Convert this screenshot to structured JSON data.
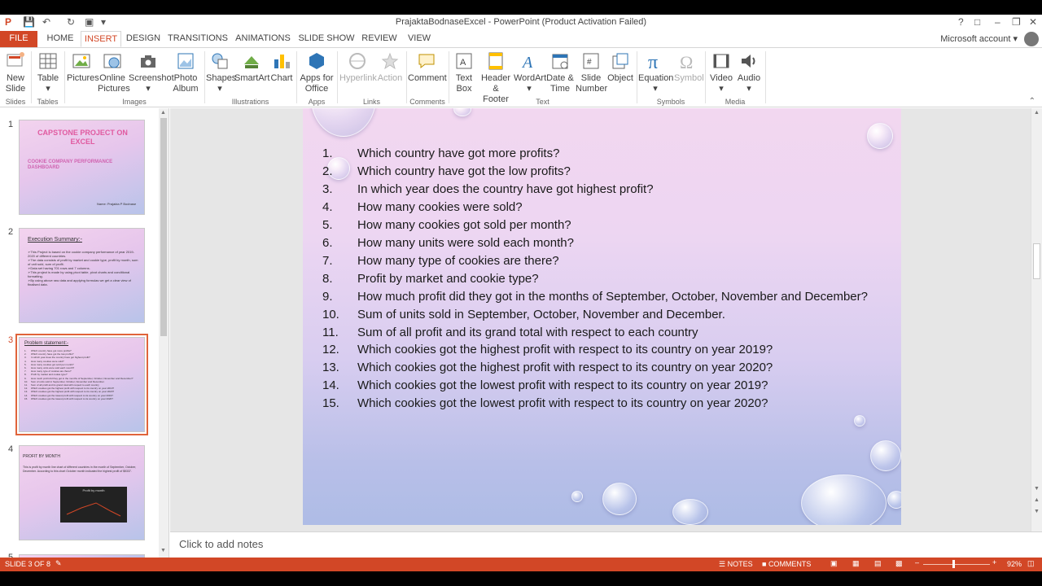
{
  "window": {
    "title": "PrajaktaBodnaseExcel - PowerPoint (Product Activation Failed)",
    "account": "Microsoft account",
    "help": "?"
  },
  "tabs": [
    "FILE",
    "HOME",
    "INSERT",
    "DESIGN",
    "TRANSITIONS",
    "ANIMATIONS",
    "SLIDE SHOW",
    "REVIEW",
    "VIEW"
  ],
  "active_tab": "INSERT",
  "ribbon": {
    "buttons": {
      "new_slide": "New Slide",
      "table": "Table",
      "pictures": "Pictures",
      "online_pictures": "Online Pictures",
      "screenshot": "Screenshot",
      "photo_album": "Photo Album",
      "shapes": "Shapes",
      "smartart": "SmartArt",
      "chart": "Chart",
      "apps_for_office": "Apps for Office",
      "hyperlink": "Hyperlink",
      "action": "Action",
      "comment": "Comment",
      "text_box": "Text Box",
      "header_footer": "Header & Footer",
      "wordart": "WordArt",
      "date_time": "Date & Time",
      "slide_number": "Slide Number",
      "object": "Object",
      "equation": "Equation",
      "symbol": "Symbol",
      "video": "Video",
      "audio": "Audio"
    },
    "groups": {
      "slides": "Slides",
      "tables": "Tables",
      "images": "Images",
      "illustrations": "Illustrations",
      "apps": "Apps",
      "links": "Links",
      "comments": "Comments",
      "text": "Text",
      "symbols": "Symbols",
      "media": "Media"
    }
  },
  "thumbnails": {
    "numbers": [
      "1",
      "2",
      "3",
      "4",
      "5"
    ],
    "slide1": {
      "title": "CAPSTONE PROJECT ON EXCEL",
      "subtitle": "COOKIE COMPANY PERFORMANCE DASHBOARD",
      "name": "Name: Prajakta P Bodnase"
    },
    "slide2": {
      "title": "Execution Summary:-",
      "lines": [
        "➢This Project is based on the cookie company performance of year 2019-2020 of different countries.",
        "➢The data consists of profit by market and cookie type, profit by month, sum of unit sold, sum of profit.",
        "➢Data set having 701 rows and 7 columns.",
        "➢This project is made by using pivot table, pivot charts and conditional formatting.",
        "➢By using above raw data and applying formulas we get a clear view of finalised data."
      ]
    },
    "slide3": {
      "title": "Problem statement:-"
    },
    "slide4": {
      "title": "PROFIT BY MONTH",
      "text": "This is profit by month line chart of different countries in the month of September, October, December. According to this chart October month indicated the highest profit of $5337.",
      "chart_title": "Profit by month"
    }
  },
  "slide": {
    "questions": [
      {
        "num": "1.",
        "text": "Which country have got more profits?"
      },
      {
        "num": "2.",
        "text": "Which country have got the low profits?"
      },
      {
        "num": "3.",
        "text": "In which year does the country have got highest profit?"
      },
      {
        "num": "4.",
        "text": "How many cookies were sold?"
      },
      {
        "num": "5.",
        "text": "How many cookies got sold per month?"
      },
      {
        "num": "6.",
        "text": "How many units were sold each month?"
      },
      {
        "num": "7.",
        "text": "How many type of cookies are there?"
      },
      {
        "num": "8.",
        "text": "Profit by market and cookie type?"
      },
      {
        "num": "9.",
        "text": "How much profit did they got in the months of September, October, November and December?"
      },
      {
        "num": "10.",
        "text": "Sum of units sold in September, October, November and December."
      },
      {
        "num": "11.",
        "text": "Sum of all profit and its grand total with respect to each country"
      },
      {
        "num": "12.",
        "text": "Which cookies got the highest profit with respect to its country on year 2019?"
      },
      {
        "num": "13.",
        "text": "Which cookies got the highest profit with respect to its country on year 2020?"
      },
      {
        "num": "14.",
        "text": "Which cookies got the lowest profit with respect to its country on year 2019?"
      },
      {
        "num": "15.",
        "text": "Which cookies got the lowest profit with respect to its country on year 2020?"
      }
    ]
  },
  "notes": {
    "placeholder": "Click to add notes"
  },
  "status": {
    "slide_info": "SLIDE 3 OF 8",
    "notes": "NOTES",
    "comments": "COMMENTS",
    "zoom": "92%"
  },
  "colors": {
    "accent": "#d24726",
    "ribbon_icon_blue": "#2e75b6"
  }
}
